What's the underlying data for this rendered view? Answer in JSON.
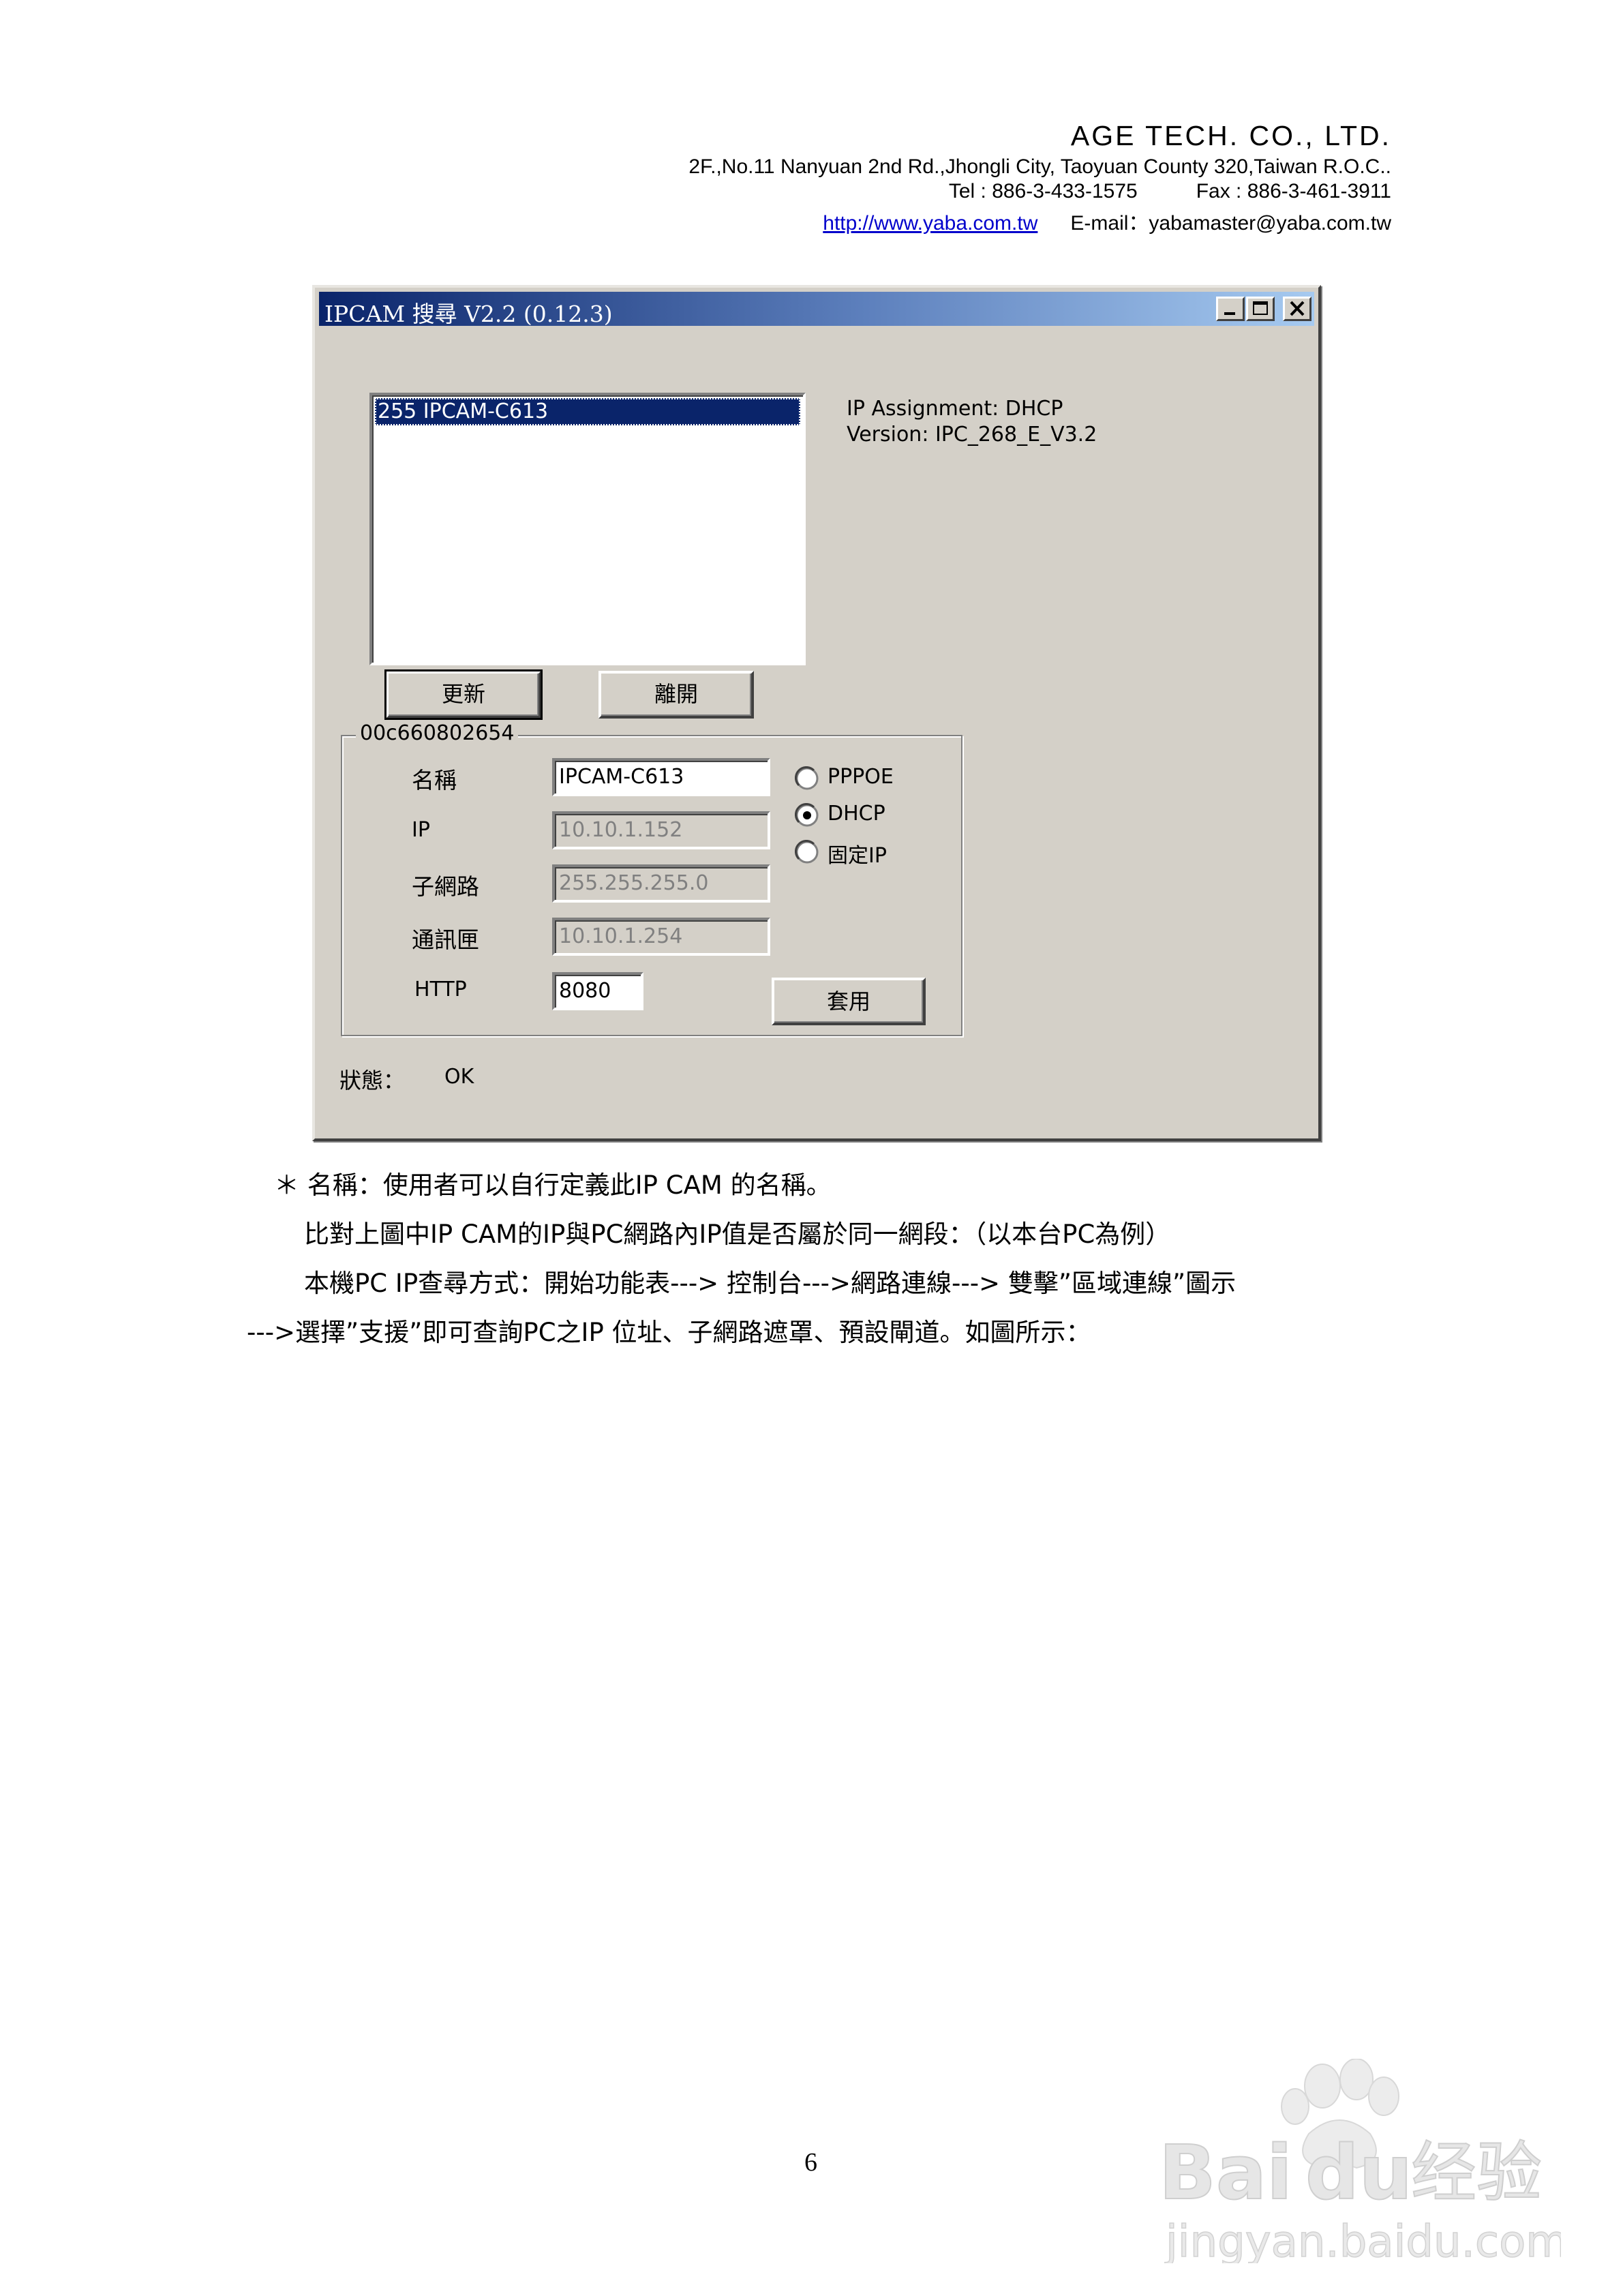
{
  "letterhead": {
    "company": "AGE TECH. CO., LTD.",
    "address": "2F.,No.11 Nanyuan 2nd Rd.,Jhongli City, Taoyuan County 320,Taiwan R.O.C..",
    "tel": "Tel : 886-3-433-1575",
    "fax": "Fax : 886-3-461-3911",
    "website": "http://www.yaba.com.tw",
    "email": "E-mail：yabamaster@yaba.com.tw"
  },
  "dialog": {
    "title": "IPCAM 搜尋 V2.2 (0.12.3)",
    "device_list": [
      "255 IPCAM-C613"
    ],
    "info_assignment": "IP Assignment:  DHCP",
    "info_version": "Version: IPC_268_E_V3.2",
    "refresh_label": "更新",
    "leave_label": "離開",
    "group_title": "00c660802654",
    "fields": {
      "name_label": "名稱",
      "name_value": "IPCAM-C613",
      "ip_label": "IP",
      "ip_value": "10.10.1.152",
      "subnet_label": "子網路",
      "subnet_value": "255.255.255.0",
      "gateway_label": "通訊匣",
      "gateway_value": "10.10.1.254",
      "http_label": "HTTP",
      "http_value": "8080"
    },
    "radios": {
      "pppoe": "PPPOE",
      "dhcp": "DHCP",
      "static": "固定IP",
      "selected": "dhcp"
    },
    "apply_label": "套用",
    "status_label": "狀態：",
    "status_value": "OK"
  },
  "body": {
    "p1": "＊ 名稱：使用者可以自行定義此IP CAM 的名稱。",
    "p2": "比對上圖中IP CAM的IP與PC網路內IP值是否屬於同一網段：（以本台PC為例）",
    "p3": "本機PC IP查尋方式：開始功能表---> 控制台--->網路連線---> 雙擊”區域連線”圖示",
    "p4": "--->選擇”支援”即可查詢PC之IP 位址、子網路遮罩、預設閘道。如圖所示："
  },
  "page_number": "6",
  "watermark": {
    "brand": "Bai",
    "brand2": "du",
    "cn": "经验",
    "url": "jingyan.baidu.com"
  }
}
